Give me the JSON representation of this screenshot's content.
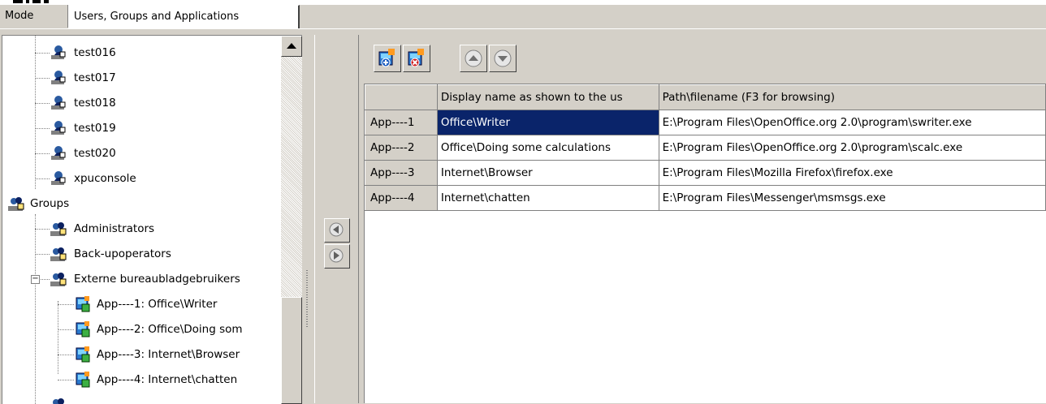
{
  "tabs": [
    {
      "label": "Mode",
      "active": false
    },
    {
      "label": "Users, Groups and Applications",
      "active": true
    }
  ],
  "tree": {
    "users": [
      "test016",
      "test017",
      "test018",
      "test019",
      "test020",
      "xpuconsole"
    ],
    "groups_label": "Groups",
    "groups": [
      "Administrators",
      "Back-upoperators",
      "Externe bureaubladgebruikers"
    ],
    "external_apps": [
      "App----1: Office\\Writer",
      "App----2: Office\\Doing som",
      "App----3: Internet\\Browser",
      "App----4: Internet\\chatten"
    ]
  },
  "toolbar": {
    "add_app_icon": "add-application-icon",
    "remove_app_icon": "remove-application-icon",
    "move_up_icon": "move-up-icon",
    "move_down_icon": "move-down-icon"
  },
  "grid": {
    "headers": [
      "",
      "Display name as shown to the us",
      "Path\\filename (F3 for browsing)"
    ],
    "rows": [
      {
        "id": "App----1",
        "display": "Office\\Writer",
        "path": "E:\\Program Files\\OpenOffice.org 2.0\\program\\swriter.exe",
        "selected": true
      },
      {
        "id": "App----2",
        "display": "Office\\Doing some calculations",
        "path": "E:\\Program Files\\OpenOffice.org 2.0\\program\\scalc.exe",
        "selected": false
      },
      {
        "id": "App----3",
        "display": "Internet\\Browser",
        "path": "E:\\Program Files\\Mozilla Firefox\\firefox.exe",
        "selected": false
      },
      {
        "id": "App----4",
        "display": "Internet\\chatten",
        "path": "E:\\Program Files\\Messenger\\msmsgs.exe",
        "selected": false
      }
    ]
  },
  "colors": {
    "face": "#d4d0c8",
    "selection": "#0a246a"
  }
}
